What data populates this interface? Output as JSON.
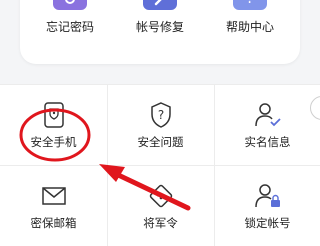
{
  "top_row": [
    {
      "label": "忘记密码",
      "icon": "lock-refresh-icon",
      "color": "#7d67d9"
    },
    {
      "label": "帐号修复",
      "icon": "wrench-icon",
      "color": "#5c6bd6"
    },
    {
      "label": "帮助中心",
      "icon": "question-icon",
      "color": "#7c8fe6"
    }
  ],
  "grid": [
    {
      "label": "安全手机",
      "icon": "phone-shield-icon"
    },
    {
      "label": "安全问题",
      "icon": "question-shield-icon"
    },
    {
      "label": "实名信息",
      "icon": "user-check-icon"
    },
    {
      "label": "密保邮箱",
      "icon": "mail-icon"
    },
    {
      "label": "将军令",
      "icon": "token-icon"
    },
    {
      "label": "锁定帐号",
      "icon": "user-lock-icon"
    }
  ],
  "annotation_color": "#e0161d"
}
